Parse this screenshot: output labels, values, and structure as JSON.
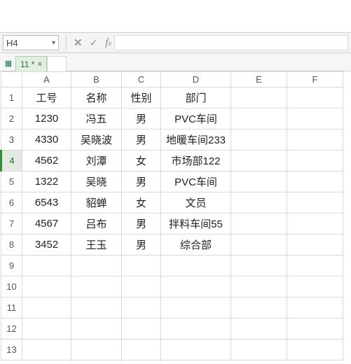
{
  "namebox": {
    "value": "H4"
  },
  "tab": {
    "label": "11 *"
  },
  "columns": [
    "A",
    "B",
    "C",
    "D",
    "E",
    "F"
  ],
  "row_count": 13,
  "active_row": 4,
  "header_row": {
    "A": "工号",
    "B": "名称",
    "C": "性别",
    "D": "部门"
  },
  "data_rows": [
    {
      "A": "1230",
      "B": "冯五",
      "C": "男",
      "D": "PVC车间"
    },
    {
      "A": "4330",
      "B": "吴晓波",
      "C": "男",
      "D": "地暖车间233"
    },
    {
      "A": "4562",
      "B": "刘潭",
      "C": "女",
      "D": "市场部122"
    },
    {
      "A": "1322",
      "B": "吴晓",
      "C": "男",
      "D": "PVC车间"
    },
    {
      "A": "6543",
      "B": "貂蝉",
      "C": "女",
      "D": "文员"
    },
    {
      "A": "4567",
      "B": "吕布",
      "C": "男",
      "D": "拌料车间55"
    },
    {
      "A": "3452",
      "B": "王玉",
      "C": "男",
      "D": "综合部"
    }
  ],
  "chart_data": {
    "type": "table",
    "columns": [
      "工号",
      "名称",
      "性别",
      "部门"
    ],
    "rows": [
      [
        "1230",
        "冯五",
        "男",
        "PVC车间"
      ],
      [
        "4330",
        "吴晓波",
        "男",
        "地暖车间233"
      ],
      [
        "4562",
        "刘潭",
        "女",
        "市场部122"
      ],
      [
        "1322",
        "吴晓",
        "男",
        "PVC车间"
      ],
      [
        "6543",
        "貂蝉",
        "女",
        "文员"
      ],
      [
        "4567",
        "吕布",
        "男",
        "拌料车间55"
      ],
      [
        "3452",
        "王玉",
        "男",
        "综合部"
      ]
    ]
  }
}
